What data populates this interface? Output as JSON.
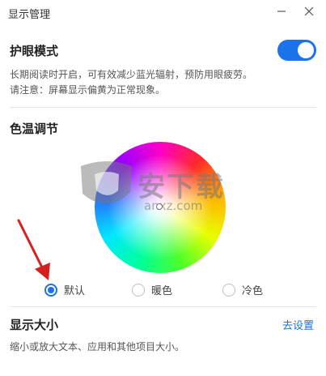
{
  "window": {
    "title": "显示管理"
  },
  "eye_protection": {
    "title": "护眼模式",
    "enabled": true,
    "desc_line1": "长期阅读时开启，可有效减少蓝光辐射，预防用眼疲劳。",
    "desc_line2": "请注意：屏幕显示偏黄为正常现象。"
  },
  "color_temp": {
    "title": "色温调节",
    "options": [
      "默认",
      "暖色",
      "冷色"
    ],
    "selected": "默认"
  },
  "display_size": {
    "title": "显示大小",
    "link": "去设置",
    "desc": "缩小或放大文本、应用和其他项目大小。"
  },
  "watermark": {
    "text": "安下载",
    "sub": "anxz.com"
  },
  "colors": {
    "accent": "#1a73e8",
    "arrow": "#d61f1f"
  }
}
